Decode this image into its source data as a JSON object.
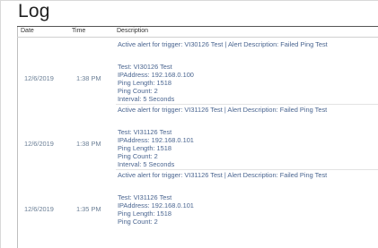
{
  "window": {
    "title": "Log"
  },
  "columns": {
    "date": "Date",
    "time": "Time",
    "description": "Description"
  },
  "rows": [
    {
      "alert": "Active alert for trigger: VI30126 Test | Alert Description: Failed Ping Test",
      "date": "12/6/2019",
      "time": "1:38 PM",
      "details": [
        "Test: VI30126 Test",
        "IPAddress: 192.168.0.100",
        "Ping Length: 1518",
        "Ping Count: 2",
        "Interval: 5 Seconds"
      ]
    },
    {
      "alert": "Active alert for trigger: VI31126 Test | Alert Description: Failed Ping Test",
      "date": "12/6/2019",
      "time": "1:38 PM",
      "details": [
        "Test: VI31126 Test",
        "IPAddress: 192.168.0.101",
        "Ping Length: 1518",
        "Ping Count: 2",
        "Interval: 5 Seconds"
      ]
    },
    {
      "alert": "Active alert for trigger: VI31126 Test | Alert Description: Failed Ping Test",
      "date": "12/6/2019",
      "time": "1:35 PM",
      "details": [
        "Test: VI31126 Test",
        "IPAddress: 192.168.0.101",
        "Ping Length: 1518",
        "Ping Count: 2"
      ]
    }
  ]
}
